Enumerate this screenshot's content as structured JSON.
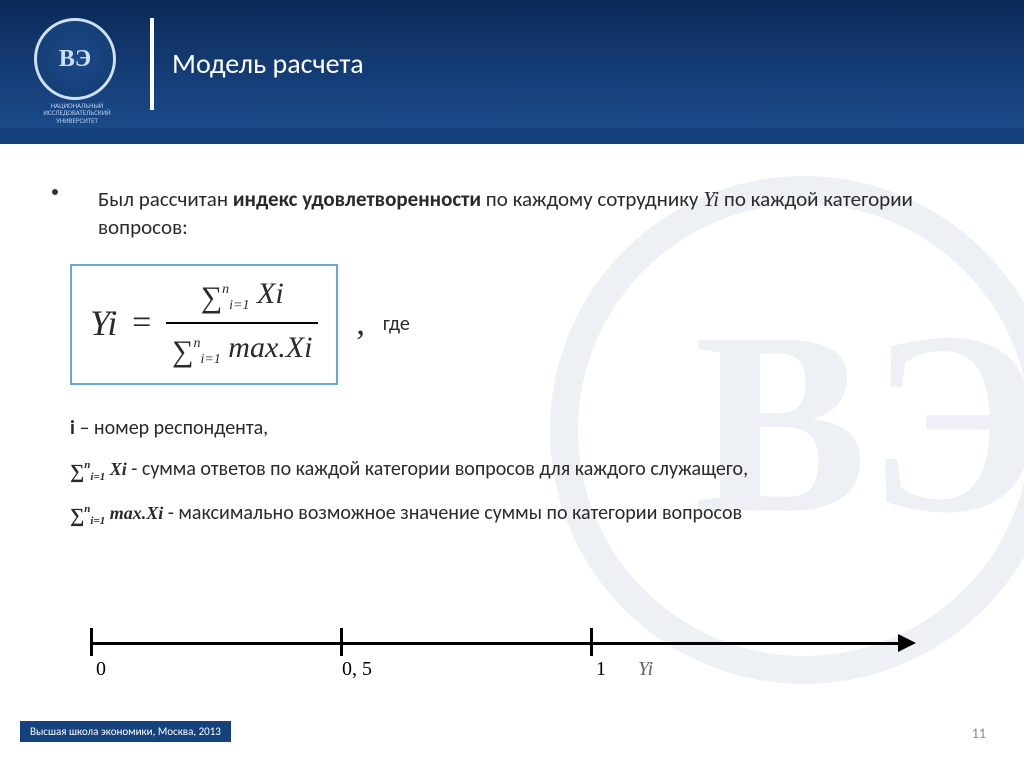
{
  "header": {
    "title": "Модель расчета",
    "logo_letters": "ВЭ",
    "logo_caption": "НАЦИОНАЛЬНЫЙ ИССЛЕДОВАТЕЛЬСКИЙ УНИВЕРСИТЕТ"
  },
  "body": {
    "intro_pre": "Был рассчитан ",
    "intro_bold": "индекс удовлетворенности",
    "intro_post": " по каждому сотруднику ",
    "intro_yi": "Yi",
    "intro_tail": " по каждой категории вопросов:",
    "formula": {
      "lhs": "Yi",
      "eq": "=",
      "num_sum": "∑",
      "num_lower": "i=1",
      "num_upper": "n",
      "num_term": " Xi",
      "den_sum": "∑",
      "den_lower": "i=1",
      "den_upper": "n",
      "den_term": " max.Xi",
      "comma": ",",
      "where": "где"
    },
    "defs": {
      "i_label": "i",
      "i_text": " – номер респондента,",
      "sumXi_inline": "∑ⁿᵢ₌₁ Xi",
      "sumXi_text": "  -  сумма  ответов  по  каждой  категории  вопросов  для  каждого служащего,",
      "sumMax_inline": "∑ⁿᵢ₌₁ max.Xi",
      "sumMax_text": "  -  максимально  возможное  значение  суммы  по  категории вопросов"
    }
  },
  "axis": {
    "t0": "0",
    "t1": "0, 5",
    "t2": "1",
    "var": "Yi"
  },
  "footer": {
    "org": "Высшая школа экономики, Москва, 2013",
    "page": "11"
  }
}
